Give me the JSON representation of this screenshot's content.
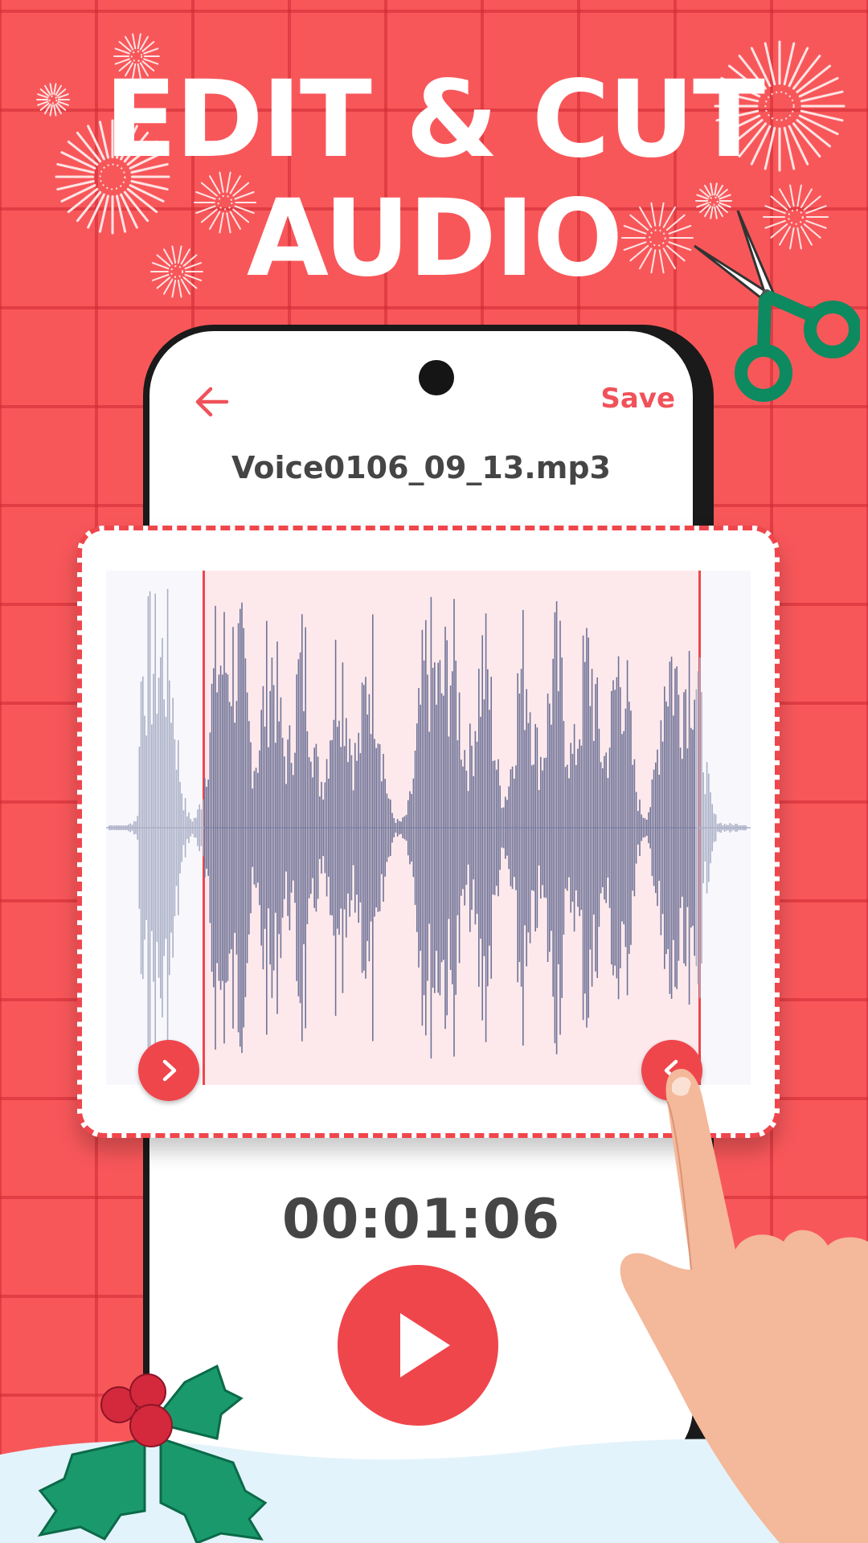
{
  "headline": {
    "line1": "EDIT & CUT",
    "line2": "AUDIO"
  },
  "editor": {
    "back_icon": "arrow-left-icon",
    "save_label": "Save",
    "file_name": "Voice0106_09_13.mp3",
    "time": "00:01:06",
    "play_icon": "play-icon"
  },
  "trim": {
    "start_handle_icon": "chevron-right-icon",
    "end_handle_icon": "chevron-left-icon"
  },
  "colors": {
    "background": "#f8575a",
    "accent": "#ef464c",
    "waveform_selected": "#6f7397",
    "waveform_unselected": "#aab0c6",
    "selection_fill": "#fde9ec"
  }
}
